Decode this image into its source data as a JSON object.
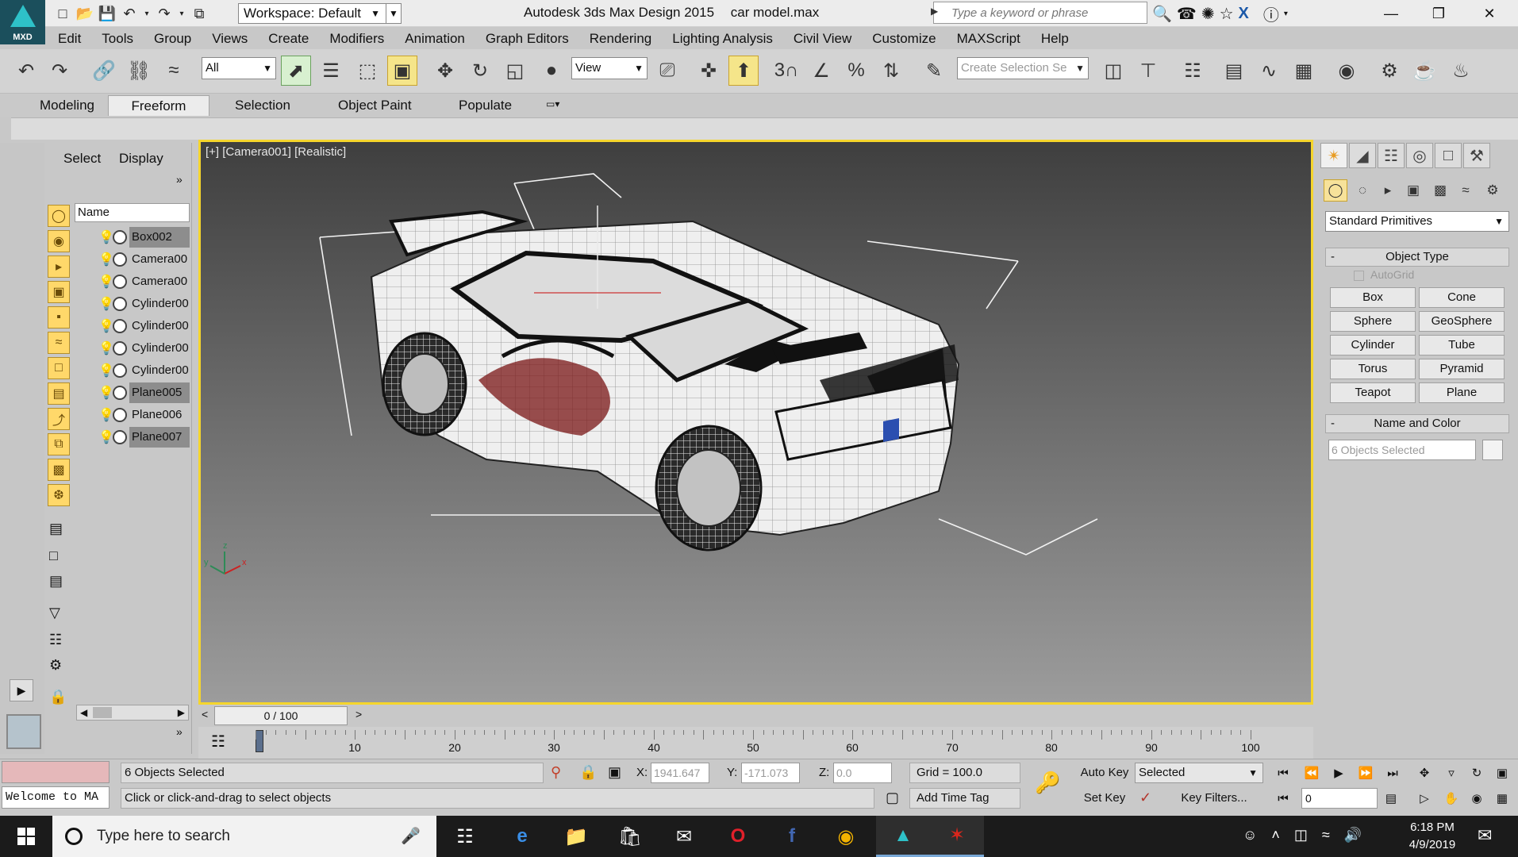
{
  "app": {
    "logo_label": "MXD",
    "title": "Autodesk 3ds Max Design 2015",
    "filename": "car model.max",
    "workspace": "Workspace: Default",
    "search_placeholder": "Type a keyword or phrase"
  },
  "menu": [
    "Edit",
    "Tools",
    "Group",
    "Views",
    "Create",
    "Modifiers",
    "Animation",
    "Graph Editors",
    "Rendering",
    "Lighting Analysis",
    "Civil View",
    "Customize",
    "MAXScript",
    "Help"
  ],
  "toolbar": {
    "filter_value": "All",
    "refcoord_value": "View",
    "named_selection_placeholder": "Create Selection Se"
  },
  "ribbon": {
    "tabs": [
      "Modeling",
      "Freeform",
      "Selection",
      "Object Paint",
      "Populate"
    ],
    "active": "Freeform"
  },
  "explorer": {
    "tabs": [
      "Select",
      "Display"
    ],
    "column": "Name",
    "items": [
      {
        "name": "Box002",
        "selected": true
      },
      {
        "name": "Camera00",
        "selected": false
      },
      {
        "name": "Camera00",
        "selected": false
      },
      {
        "name": "Cylinder00",
        "selected": false
      },
      {
        "name": "Cylinder00",
        "selected": false
      },
      {
        "name": "Cylinder00",
        "selected": false
      },
      {
        "name": "Cylinder00",
        "selected": false
      },
      {
        "name": "Plane005",
        "selected": true
      },
      {
        "name": "Plane006",
        "selected": false
      },
      {
        "name": "Plane007",
        "selected": true
      }
    ]
  },
  "viewport": {
    "label": "[+] [Camera001] [Realistic]",
    "axis_labels": {
      "x": "x",
      "y": "y",
      "z": "z"
    }
  },
  "command_panel": {
    "category": "Standard Primitives",
    "object_type_title": "Object Type",
    "autogrid_label": "AutoGrid",
    "primitives": [
      "Box",
      "Cone",
      "Sphere",
      "GeoSphere",
      "Cylinder",
      "Tube",
      "Torus",
      "Pyramid",
      "Teapot",
      "Plane"
    ],
    "name_color_title": "Name and Color",
    "name_value": "6 Objects Selected"
  },
  "timeline": {
    "slider_text": "0 / 100",
    "ticks": [
      10,
      20,
      30,
      40,
      50,
      60,
      70,
      80,
      90,
      100
    ]
  },
  "status": {
    "listener_text": "Welcome to MA",
    "selection_info": "6 Objects Selected",
    "prompt": "Click or click-and-drag to select objects",
    "x_label": "X:",
    "x_value": "1941.647",
    "y_label": "Y:",
    "y_value": "-171.073",
    "z_label": "Z:",
    "z_value": "0.0",
    "grid": "Grid = 100.0",
    "add_time_tag": "Add Time Tag",
    "auto_key": "Auto Key",
    "set_key": "Set Key",
    "key_mode": "Selected",
    "key_filters": "Key Filters...",
    "frame": "0"
  },
  "taskbar": {
    "search_placeholder": "Type here to search",
    "time": "6:18 PM",
    "date": "4/9/2019"
  },
  "colors": {
    "viewport_border": "#f5d52c",
    "taskbar": "#1b1b1b",
    "selected_row": "#8d8d8d"
  }
}
